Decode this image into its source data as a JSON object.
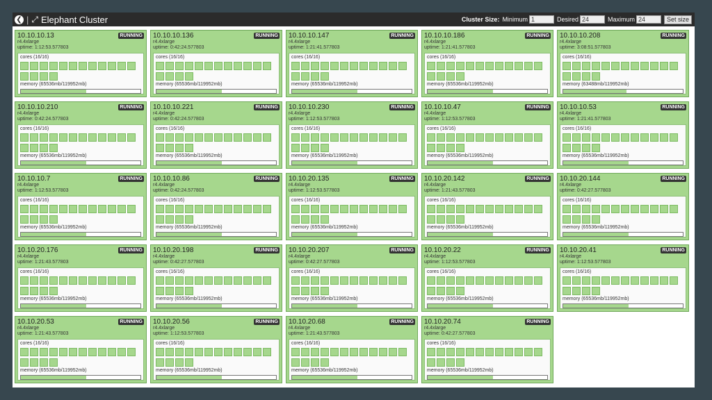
{
  "header": {
    "back_icon": "back-arrow-icon",
    "expand_icon": "expand-icon",
    "title": "Elephant Cluster",
    "cluster_size_label": "Cluster Size:",
    "minimum_label": "Minimum",
    "minimum_value": "1",
    "desired_label": "Desired",
    "desired_value": "24",
    "maximum_label": "Maximum",
    "maximum_value": "24",
    "set_size_label": "Set size"
  },
  "colors": {
    "card_bg": "#a6d78d",
    "card_border": "#6fa85a",
    "badge_bg": "#333333",
    "topbar_bg": "#2b2b2b"
  },
  "nodes": [
    {
      "ip": "10.10.10.13",
      "type": "r4.4xlarge",
      "uptime": "uptime: 1:12:53.577803",
      "status": "RUNNING",
      "cores": "cores (16/16)",
      "core_count": 16,
      "memory": "memory (65536mb/119952mb)",
      "memory_fraction": 0.546
    },
    {
      "ip": "10.10.10.136",
      "type": "r4.4xlarge",
      "uptime": "uptime: 0:42:24.577803",
      "status": "RUNNING",
      "cores": "cores (16/16)",
      "core_count": 16,
      "memory": "memory (65536mb/119952mb)",
      "memory_fraction": 0.546
    },
    {
      "ip": "10.10.10.147",
      "type": "r4.4xlarge",
      "uptime": "uptime: 1:21:41.577803",
      "status": "RUNNING",
      "cores": "cores (16/16)",
      "core_count": 16,
      "memory": "memory (65536mb/119952mb)",
      "memory_fraction": 0.546
    },
    {
      "ip": "10.10.10.186",
      "type": "r4.4xlarge",
      "uptime": "uptime: 1:21:41.577803",
      "status": "RUNNING",
      "cores": "cores (16/16)",
      "core_count": 16,
      "memory": "memory (65536mb/119952mb)",
      "memory_fraction": 0.546
    },
    {
      "ip": "10.10.10.208",
      "type": "r4.4xlarge",
      "uptime": "uptime: 3:08:51.577803",
      "status": "RUNNING",
      "cores": "cores (16/16)",
      "core_count": 16,
      "memory": "memory (63488mb/119952mb)",
      "memory_fraction": 0.529
    },
    {
      "ip": "10.10.10.210",
      "type": "r4.4xlarge",
      "uptime": "uptime: 0:42:24.577803",
      "status": "RUNNING",
      "cores": "cores (16/16)",
      "core_count": 16,
      "memory": "memory (65536mb/119952mb)",
      "memory_fraction": 0.546
    },
    {
      "ip": "10.10.10.221",
      "type": "r4.4xlarge",
      "uptime": "uptime: 0:42:24.577803",
      "status": "RUNNING",
      "cores": "cores (16/16)",
      "core_count": 16,
      "memory": "memory (65536mb/119952mb)",
      "memory_fraction": 0.546
    },
    {
      "ip": "10.10.10.230",
      "type": "r4.4xlarge",
      "uptime": "uptime: 1:12:53.577803",
      "status": "RUNNING",
      "cores": "cores (16/16)",
      "core_count": 16,
      "memory": "memory (65536mb/119952mb)",
      "memory_fraction": 0.546
    },
    {
      "ip": "10.10.10.47",
      "type": "r4.4xlarge",
      "uptime": "uptime: 1:12:53.577803",
      "status": "RUNNING",
      "cores": "cores (16/16)",
      "core_count": 16,
      "memory": "memory (65536mb/119952mb)",
      "memory_fraction": 0.546
    },
    {
      "ip": "10.10.10.53",
      "type": "r4.4xlarge",
      "uptime": "uptime: 1:21:41.577803",
      "status": "RUNNING",
      "cores": "cores (16/16)",
      "core_count": 16,
      "memory": "memory (65536mb/119952mb)",
      "memory_fraction": 0.546
    },
    {
      "ip": "10.10.10.7",
      "type": "r4.4xlarge",
      "uptime": "uptime: 1:12:53.577803",
      "status": "RUNNING",
      "cores": "cores (16/16)",
      "core_count": 16,
      "memory": "memory (65536mb/119952mb)",
      "memory_fraction": 0.546
    },
    {
      "ip": "10.10.10.86",
      "type": "r4.4xlarge",
      "uptime": "uptime: 0:42:24.577803",
      "status": "RUNNING",
      "cores": "cores (16/16)",
      "core_count": 16,
      "memory": "memory (65536mb/119952mb)",
      "memory_fraction": 0.546
    },
    {
      "ip": "10.10.20.135",
      "type": "r4.4xlarge",
      "uptime": "uptime: 1:12:53.577803",
      "status": "RUNNING",
      "cores": "cores (16/16)",
      "core_count": 16,
      "memory": "memory (65536mb/119952mb)",
      "memory_fraction": 0.546
    },
    {
      "ip": "10.10.20.142",
      "type": "r4.4xlarge",
      "uptime": "uptime: 1:21:43.577803",
      "status": "RUNNING",
      "cores": "cores (16/16)",
      "core_count": 16,
      "memory": "memory (65536mb/119952mb)",
      "memory_fraction": 0.546
    },
    {
      "ip": "10.10.20.144",
      "type": "r4.4xlarge",
      "uptime": "uptime: 0:42:27.577803",
      "status": "RUNNING",
      "cores": "cores (16/16)",
      "core_count": 16,
      "memory": "memory (65536mb/119952mb)",
      "memory_fraction": 0.546
    },
    {
      "ip": "10.10.20.176",
      "type": "r4.4xlarge",
      "uptime": "uptime: 1:21:43.577803",
      "status": "RUNNING",
      "cores": "cores (16/16)",
      "core_count": 16,
      "memory": "memory (65536mb/119952mb)",
      "memory_fraction": 0.546
    },
    {
      "ip": "10.10.20.198",
      "type": "r4.4xlarge",
      "uptime": "uptime: 0:42:27.577803",
      "status": "RUNNING",
      "cores": "cores (16/16)",
      "core_count": 16,
      "memory": "memory (65536mb/119952mb)",
      "memory_fraction": 0.546
    },
    {
      "ip": "10.10.20.207",
      "type": "r4.4xlarge",
      "uptime": "uptime: 0:42:27.577803",
      "status": "RUNNING",
      "cores": "cores (16/16)",
      "core_count": 16,
      "memory": "memory (65536mb/119952mb)",
      "memory_fraction": 0.546
    },
    {
      "ip": "10.10.20.22",
      "type": "r4.4xlarge",
      "uptime": "uptime: 1:12:53.577803",
      "status": "RUNNING",
      "cores": "cores (16/16)",
      "core_count": 16,
      "memory": "memory (65536mb/119952mb)",
      "memory_fraction": 0.546
    },
    {
      "ip": "10.10.20.41",
      "type": "r4.4xlarge",
      "uptime": "uptime: 1:12:53.577803",
      "status": "RUNNING",
      "cores": "cores (16/16)",
      "core_count": 16,
      "memory": "memory (65536mb/119952mb)",
      "memory_fraction": 0.546
    },
    {
      "ip": "10.10.20.53",
      "type": "r4.4xlarge",
      "uptime": "uptime: 1:21:43.577803",
      "status": "RUNNING",
      "cores": "cores (16/16)",
      "core_count": 16,
      "memory": "memory (65536mb/119952mb)",
      "memory_fraction": 0.546
    },
    {
      "ip": "10.10.20.56",
      "type": "r4.4xlarge",
      "uptime": "uptime: 1:12:53.577803",
      "status": "RUNNING",
      "cores": "cores (16/16)",
      "core_count": 16,
      "memory": "memory (65536mb/119952mb)",
      "memory_fraction": 0.546
    },
    {
      "ip": "10.10.20.68",
      "type": "r4.4xlarge",
      "uptime": "uptime: 1:21:43.577803",
      "status": "RUNNING",
      "cores": "cores (16/16)",
      "core_count": 16,
      "memory": "memory (65536mb/119952mb)",
      "memory_fraction": 0.546
    },
    {
      "ip": "10.10.20.74",
      "type": "r4.4xlarge",
      "uptime": "uptime: 0:42:27.577803",
      "status": "RUNNING",
      "cores": "cores (16/16)",
      "core_count": 16,
      "memory": "memory (65536mb/119952mb)",
      "memory_fraction": 0.546
    }
  ]
}
